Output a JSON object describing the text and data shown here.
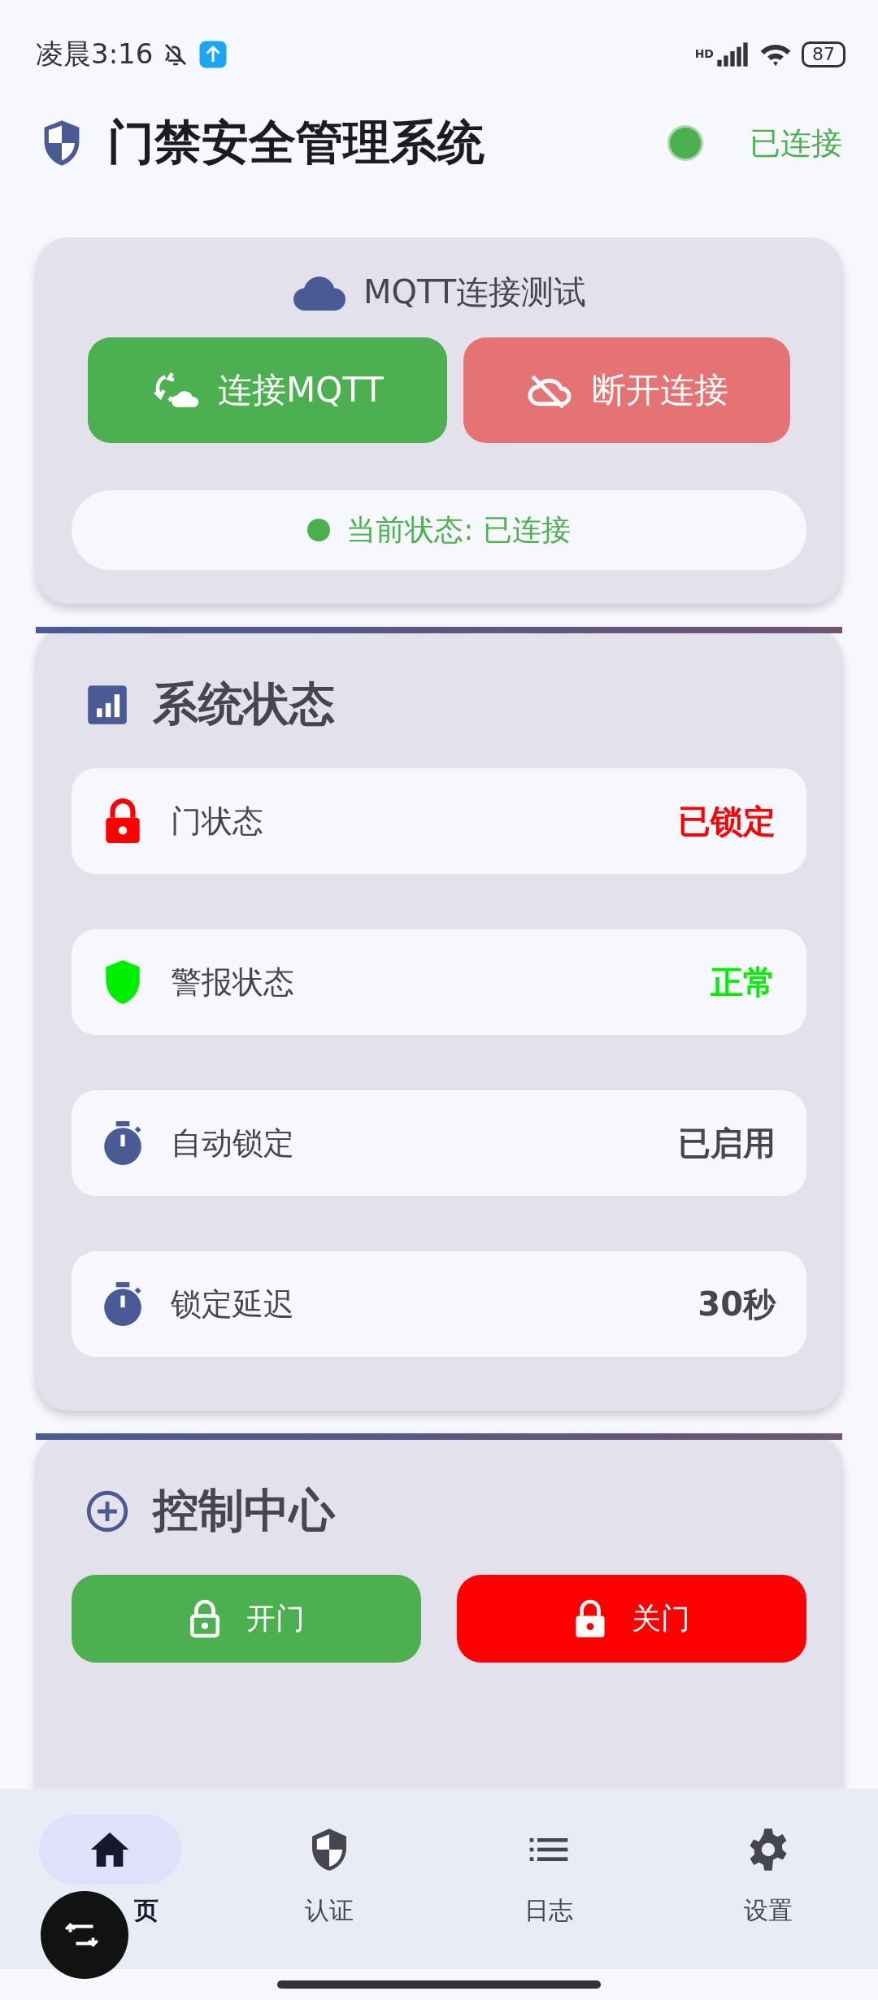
{
  "status_bar": {
    "time": "凌晨3:16",
    "network": "HD",
    "battery": "87"
  },
  "header": {
    "title": "门禁安全管理系统",
    "connected": true,
    "connection_label": "已连接"
  },
  "mqtt_card": {
    "title": "MQTT连接测试",
    "buttons": [
      {
        "label": "连接MQTT",
        "kind": "connect"
      },
      {
        "label": "断开连接",
        "kind": "disconnect"
      }
    ],
    "status_text": "当前状态: 已连接",
    "connected": true
  },
  "status_card": {
    "title": "系统状态",
    "rows": [
      {
        "label": "门状态",
        "value": "已锁定",
        "kind": "lock",
        "color": "#ff0000"
      },
      {
        "label": "警报状态",
        "value": "正常",
        "kind": "shield",
        "color": "#00ee00"
      },
      {
        "label": "自动锁定",
        "value": "已启用",
        "kind": "timer",
        "color": "#45464f"
      },
      {
        "label": "锁定延迟",
        "value": "30秒",
        "kind": "timer",
        "color": "#45464f"
      }
    ]
  },
  "control_card": {
    "title": "控制中心",
    "buttons": [
      {
        "label": "开门",
        "kind": "open"
      },
      {
        "label": "关门",
        "kind": "close"
      }
    ]
  },
  "bottom_nav": [
    {
      "label": "页",
      "kind": "home",
      "selected": true
    },
    {
      "label": "认证",
      "kind": "shield",
      "selected": false
    },
    {
      "label": "日志",
      "kind": "list",
      "selected": false
    },
    {
      "label": "设置",
      "kind": "gear",
      "selected": false
    }
  ]
}
